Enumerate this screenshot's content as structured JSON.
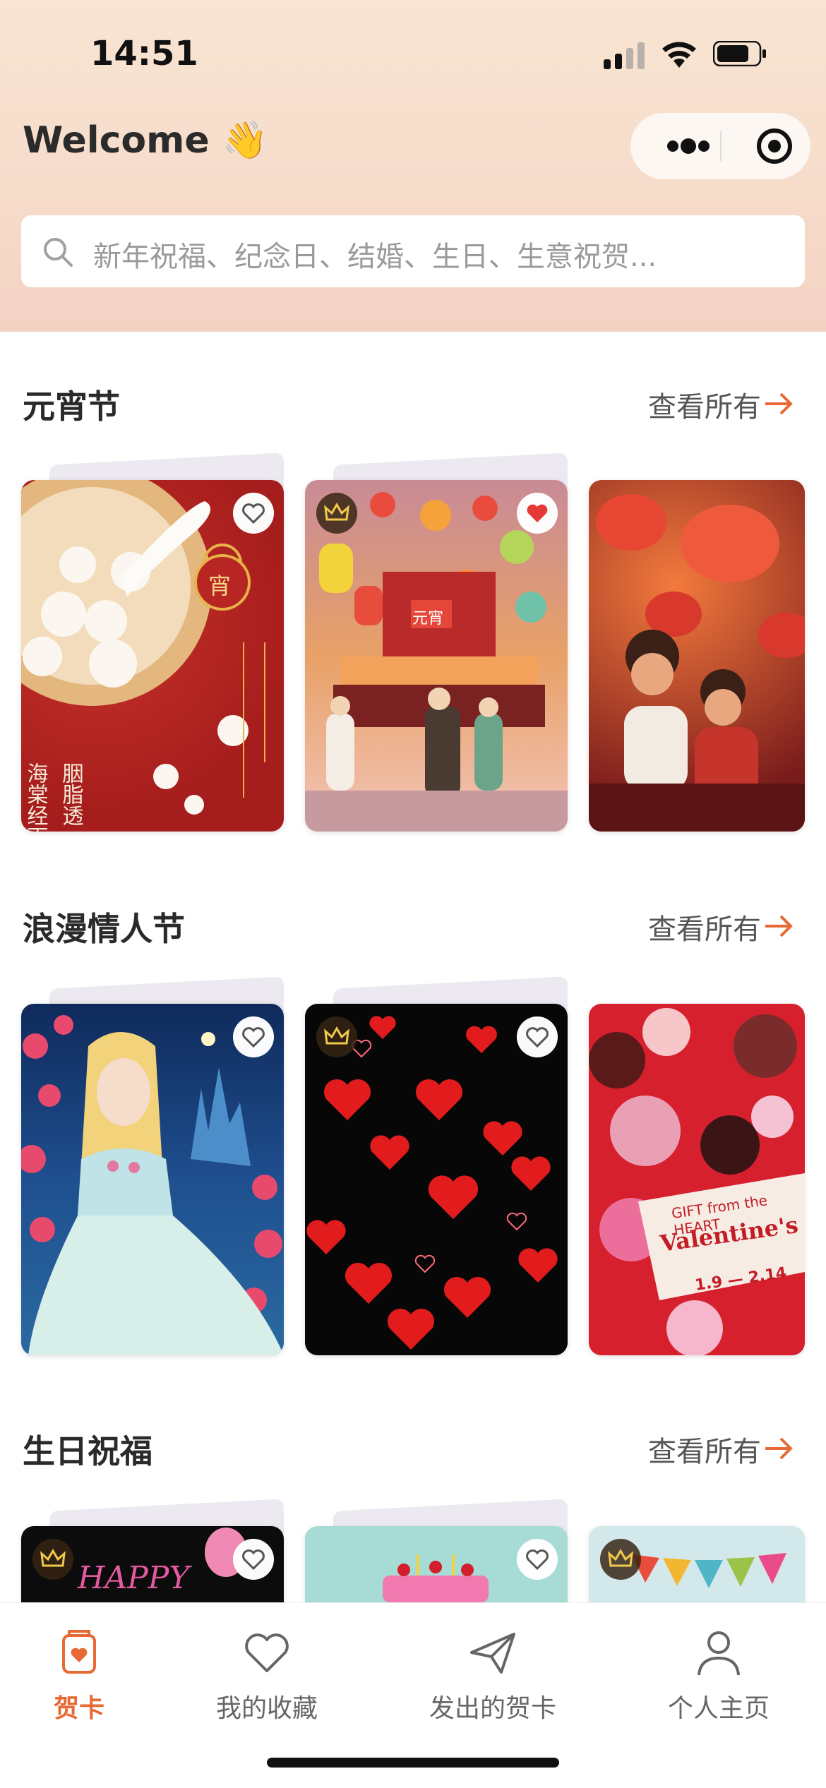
{
  "status": {
    "time": "14:51"
  },
  "header": {
    "welcome": "Welcome",
    "wave": "👋",
    "search_placeholder": "新年祝福、纪念日、结婚、生日、生意祝贺..."
  },
  "sections": [
    {
      "title": "元宵节",
      "see_all": "查看所有"
    },
    {
      "title": "浪漫情人节",
      "see_all": "查看所有"
    },
    {
      "title": "生日祝福",
      "see_all": "查看所有"
    }
  ],
  "cards": {
    "lantern_1": {
      "text": "海棠经雨 胭脂透",
      "badge": "宵"
    },
    "lantern_2": {
      "text": "元宵"
    },
    "valentine_3": {
      "line1": "GIFT from the HEART",
      "line2": "Valentine's Day",
      "date": "1.9 — 2.14"
    },
    "birthday_1": {
      "text": "HAPPY"
    }
  },
  "tabbar": [
    {
      "label": "贺卡",
      "icon": "greeting-card-icon",
      "active": true
    },
    {
      "label": "我的收藏",
      "icon": "heart-outline-icon",
      "active": false
    },
    {
      "label": "发出的贺卡",
      "icon": "paper-plane-icon",
      "active": false
    },
    {
      "label": "个人主页",
      "icon": "person-icon",
      "active": false
    }
  ],
  "colors": {
    "accent": "#e76a34"
  }
}
